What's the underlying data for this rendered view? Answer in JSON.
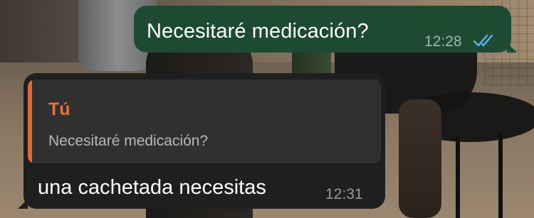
{
  "colors": {
    "outgoing_bubble": "#1e4a34",
    "incoming_bubble": "#1f1f1f",
    "quote_background": "#303030",
    "quote_accent": "#e0673a",
    "read_ticks": "#5fb0e8"
  },
  "messages": [
    {
      "direction": "outgoing",
      "text": "Necesitaré medicación?",
      "time": "12:28",
      "status_icon": "double-check-read-icon"
    },
    {
      "direction": "incoming",
      "reply_to": {
        "author": "Tú",
        "text": "Necesitaré medicación?"
      },
      "text": "una cachetada necesitas",
      "time": "12:31"
    }
  ]
}
